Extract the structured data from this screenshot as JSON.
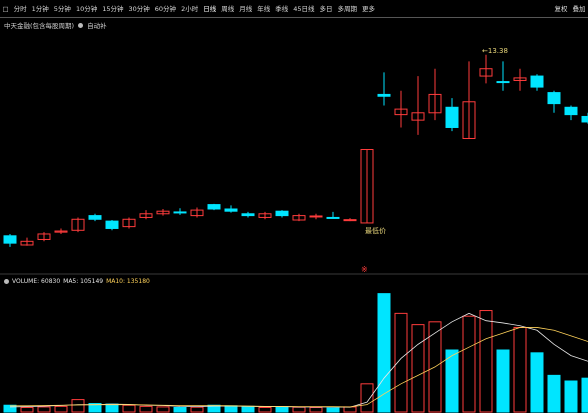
{
  "toolbar": {
    "items": [
      {
        "label": "□"
      },
      {
        "label": "分时"
      },
      {
        "label": "1分钟"
      },
      {
        "label": "5分钟"
      },
      {
        "label": "10分钟"
      },
      {
        "label": "15分钟"
      },
      {
        "label": "30分钟"
      },
      {
        "label": "60分钟"
      },
      {
        "label": "2小时"
      },
      {
        "label": "日线"
      },
      {
        "label": "周线"
      },
      {
        "label": "月线"
      },
      {
        "label": "年线"
      },
      {
        "label": "季线"
      },
      {
        "label": "45日线"
      },
      {
        "label": "多日"
      },
      {
        "label": "多周期"
      },
      {
        "label": "更多"
      }
    ],
    "right": [
      {
        "label": "复权"
      },
      {
        "label": "叠加"
      }
    ]
  },
  "subtitle": {
    "name": "中天金融(包含每股周期)",
    "tag": "自动补"
  },
  "colors": {
    "up": "#ff3c3c",
    "down": "#00e5ff",
    "ma5": "#e8e8e8",
    "ma10": "#ffd25a",
    "label": "#e8d67a"
  },
  "annotations": {
    "high_label": "←13.38",
    "low_label": "最低价",
    "marker": "※"
  },
  "volume_legend": {
    "volume": "VOLUME: 60830",
    "ma5": "MA5: 105149",
    "ma10": "MA10: 135180"
  },
  "chart_data": {
    "type": "candlestick",
    "y_range": [
      7.9,
      14.0
    ],
    "vol_range": [
      0,
      220000
    ],
    "candles": [
      {
        "o": 8.45,
        "c": 8.25,
        "h": 8.5,
        "l": 8.15,
        "v": 12000
      },
      {
        "o": 8.2,
        "c": 8.3,
        "h": 8.4,
        "l": 8.18,
        "v": 8000
      },
      {
        "o": 8.35,
        "c": 8.5,
        "h": 8.55,
        "l": 8.3,
        "v": 9000
      },
      {
        "o": 8.55,
        "c": 8.58,
        "h": 8.65,
        "l": 8.5,
        "v": 10000
      },
      {
        "o": 8.6,
        "c": 8.9,
        "h": 8.95,
        "l": 8.55,
        "v": 22000
      },
      {
        "o": 9.0,
        "c": 8.9,
        "h": 9.05,
        "l": 8.85,
        "v": 15000
      },
      {
        "o": 8.85,
        "c": 8.65,
        "h": 8.88,
        "l": 8.6,
        "v": 14000
      },
      {
        "o": 8.7,
        "c": 8.9,
        "h": 8.95,
        "l": 8.65,
        "v": 12000
      },
      {
        "o": 8.95,
        "c": 9.05,
        "h": 9.15,
        "l": 8.9,
        "v": 10000
      },
      {
        "o": 9.05,
        "c": 9.12,
        "h": 9.18,
        "l": 9.0,
        "v": 9000
      },
      {
        "o": 9.1,
        "c": 9.08,
        "h": 9.2,
        "l": 9.02,
        "v": 8000
      },
      {
        "o": 9.0,
        "c": 9.15,
        "h": 9.22,
        "l": 8.95,
        "v": 8500
      },
      {
        "o": 9.3,
        "c": 9.18,
        "h": 9.32,
        "l": 9.15,
        "v": 12000
      },
      {
        "o": 9.18,
        "c": 9.12,
        "h": 9.28,
        "l": 9.08,
        "v": 11000
      },
      {
        "o": 9.05,
        "c": 9.0,
        "h": 9.1,
        "l": 8.95,
        "v": 10000
      },
      {
        "o": 8.95,
        "c": 9.05,
        "h": 9.1,
        "l": 8.9,
        "v": 8000
      },
      {
        "o": 9.12,
        "c": 9.0,
        "h": 9.15,
        "l": 8.95,
        "v": 9500
      },
      {
        "o": 8.88,
        "c": 9.0,
        "h": 9.05,
        "l": 8.85,
        "v": 8500
      },
      {
        "o": 8.98,
        "c": 8.99,
        "h": 9.05,
        "l": 8.9,
        "v": 8000
      },
      {
        "o": 8.95,
        "c": 8.93,
        "h": 9.1,
        "l": 8.92,
        "v": 7000
      },
      {
        "o": 8.87,
        "c": 8.89,
        "h": 8.93,
        "l": 8.85,
        "v": 9000
      },
      {
        "o": 8.8,
        "c": 10.8,
        "h": 10.8,
        "l": 8.8,
        "v": 50000
      },
      {
        "o": 12.3,
        "c": 12.25,
        "h": 12.9,
        "l": 12.0,
        "v": 210000
      },
      {
        "o": 11.75,
        "c": 11.9,
        "h": 12.4,
        "l": 11.4,
        "v": 175000
      },
      {
        "o": 11.6,
        "c": 11.8,
        "h": 12.8,
        "l": 11.2,
        "v": 155000
      },
      {
        "o": 11.8,
        "c": 12.3,
        "h": 13.0,
        "l": 11.6,
        "v": 160000
      },
      {
        "o": 11.95,
        "c": 11.4,
        "h": 12.2,
        "l": 11.3,
        "v": 110000
      },
      {
        "o": 11.1,
        "c": 12.1,
        "h": 13.2,
        "l": 11.1,
        "v": 170000
      },
      {
        "o": 12.8,
        "c": 13.0,
        "h": 13.38,
        "l": 12.6,
        "v": 180000
      },
      {
        "o": 12.65,
        "c": 12.63,
        "h": 13.2,
        "l": 12.4,
        "v": 110000
      },
      {
        "o": 12.68,
        "c": 12.75,
        "h": 13.0,
        "l": 12.4,
        "v": 150000
      },
      {
        "o": 12.8,
        "c": 12.5,
        "h": 12.85,
        "l": 12.4,
        "v": 105000
      },
      {
        "o": 12.35,
        "c": 12.05,
        "h": 12.4,
        "l": 11.8,
        "v": 65000
      },
      {
        "o": 11.95,
        "c": 11.75,
        "h": 12.0,
        "l": 11.6,
        "v": 55000
      },
      {
        "o": 11.7,
        "c": 11.55,
        "h": 11.8,
        "l": 11.5,
        "v": 60000
      }
    ],
    "ma5_line": [
      9000,
      9500,
      10500,
      11500,
      13000,
      13000,
      14000,
      13500,
      12000,
      11500,
      10000,
      9500,
      10500,
      10500,
      10000,
      9500,
      9500,
      9000,
      9000,
      9000,
      8500,
      17500,
      60000,
      95000,
      120000,
      140000,
      160000,
      175000,
      162000,
      158000,
      153000,
      145000,
      120000,
      100000,
      90000
    ],
    "ma10_line": [
      11000,
      11000,
      11500,
      12000,
      12500,
      13000,
      13000,
      13000,
      12500,
      12000,
      11500,
      11500,
      11500,
      11000,
      10500,
      10000,
      10000,
      9500,
      9500,
      9500,
      9000,
      13000,
      32000,
      50000,
      65000,
      80000,
      100000,
      115000,
      130000,
      140000,
      150000,
      150000,
      145000,
      135000,
      125000
    ]
  }
}
